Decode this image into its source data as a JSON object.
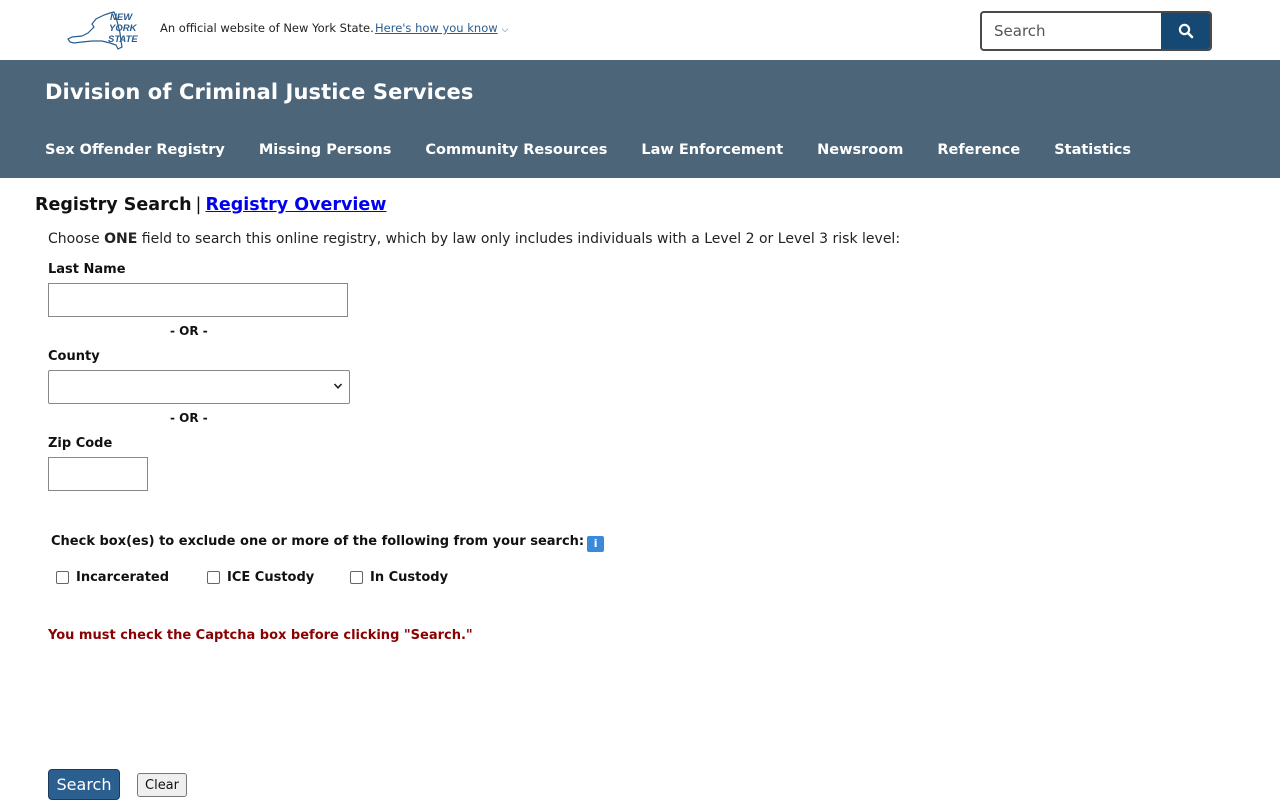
{
  "universal": {
    "logo_lines": [
      "NEW",
      "YORK",
      "STATE"
    ],
    "official_text": "An official website of New York State.",
    "how_you_know": "Here's how you know",
    "search_placeholder": "Search"
  },
  "banner": {
    "agency_title": "Division of Criminal Justice Services",
    "nav": [
      "Sex Offender Registry",
      "Missing Persons",
      "Community Resources",
      "Law Enforcement",
      "Newsroom",
      "Reference",
      "Statistics"
    ]
  },
  "main": {
    "heading": "Registry Search",
    "separator": "|",
    "overview_link": "Registry Overview",
    "intro_prefix": "Choose ",
    "intro_bold": "ONE",
    "intro_suffix": " field to search this online registry, which by law only includes individuals with a Level 2 or Level 3 risk level:",
    "last_name_label": "Last Name",
    "or_text": "- OR -",
    "county_label": "County",
    "zip_label": "Zip Code",
    "exclude_label": "Check box(es) to exclude one or more of the following from your search:",
    "info_glyph": "i",
    "checkboxes": [
      "Incarcerated",
      "ICE Custody",
      "In Custody"
    ],
    "captcha_warning": "You must check the Captcha box before clicking \"Search.\"",
    "search_button": "Search",
    "clear_button": "Clear"
  },
  "colors": {
    "banner": "#4c6579",
    "search_button": "#154973",
    "warning": "#8b0000",
    "link": "#0000ee"
  }
}
